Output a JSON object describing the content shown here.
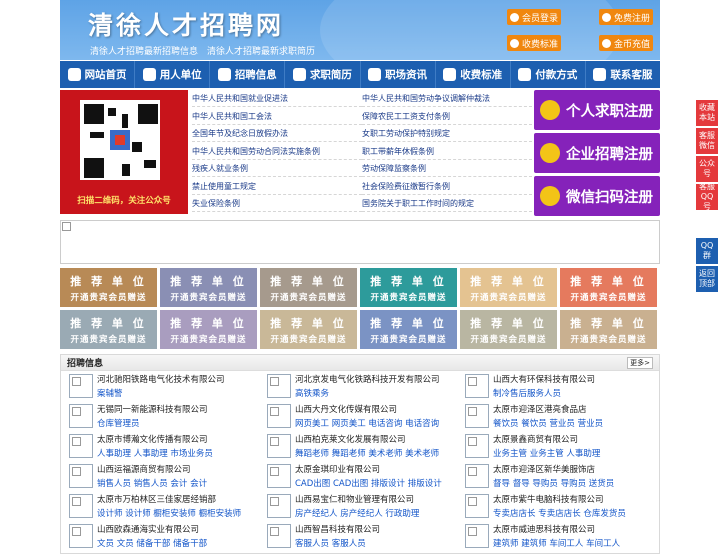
{
  "site": {
    "title": "清徐人才招聘网",
    "slogan": "清徐人才招聘最新招聘信息　清徐人才招聘最新求职简历"
  },
  "header_buttons": [
    "会员登录",
    "免费注册",
    "收费标准",
    "金币充值"
  ],
  "nav": [
    {
      "label": "网站首页",
      "icon": "home-icon"
    },
    {
      "label": "用人单位",
      "icon": "building-icon"
    },
    {
      "label": "招聘信息",
      "icon": "person-icon"
    },
    {
      "label": "求职简历",
      "icon": "resume-icon"
    },
    {
      "label": "职场资讯",
      "icon": "news-icon"
    },
    {
      "label": "收费标准",
      "icon": "coin-icon"
    },
    {
      "label": "付款方式",
      "icon": "card-icon"
    },
    {
      "label": "联系客服",
      "icon": "phone-icon"
    }
  ],
  "qr": {
    "caption": "扫描二维码，关注公众号"
  },
  "laws": [
    "中华人民共和国就业促进法",
    "中华人民共和国劳动争议调解仲裁法",
    "中华人民共和国工会法",
    "保障农民工工资支付条例",
    "全国年节及纪念日放假办法",
    "女职工劳动保护特别规定",
    "中华人民共和国劳动合同法实施条例",
    "职工带薪年休假条例",
    "残疾人就业条例",
    "劳动保障监察条例",
    "禁止使用童工规定",
    "社会保险费征缴暂行条例",
    "失业保险条例",
    "国务院关于职工工作时间的规定"
  ],
  "register": [
    "个人求职注册",
    "企业招聘注册",
    "微信扫码注册"
  ],
  "recommend": {
    "title": "推 荐 单 位",
    "subtitle": "开通贵宾会员赠送",
    "colors": [
      "#b88a56",
      "#8a8fb4",
      "#a69a8d",
      "#2d9b9b",
      "#e4c391",
      "#e57a5e",
      "#9aaab4",
      "#a99dbf",
      "#c9b898",
      "#7b93c4",
      "#b9b6a2",
      "#c9b090"
    ]
  },
  "jobs_section": {
    "title": "招聘信息",
    "more": "更多>"
  },
  "jobs": [
    {
      "company": "河北驰阳铁路电气化技术有限公司",
      "positions": "案辅警"
    },
    {
      "company": "河北京发电气化铁路科技开发有限公司",
      "positions": "高铁乘务"
    },
    {
      "company": "山西大有环保科技有限公司",
      "positions": "制冷售后服务人员"
    },
    {
      "company": "无锡同一新能源科技有限公司",
      "positions": "仓库管理员"
    },
    {
      "company": "山西大丹文化传媒有限公司",
      "positions": "网页美工 网页美工 电话咨询 电话咨询"
    },
    {
      "company": "太原市迎泽区港亮食品店",
      "positions": "餐饮员 餐饮员 营业员 营业员"
    },
    {
      "company": "太原市博瀚文化传播有限公司",
      "positions": "人事助理 人事助理 市场业务员"
    },
    {
      "company": "山西柏克莱文化发展有限公司",
      "positions": "舞蹈老师 舞蹈老师 美术老师 美术老师"
    },
    {
      "company": "太原景鑫商贸有限公司",
      "positions": "业务主管 业务主管 人事助理"
    },
    {
      "company": "山西运福源商贸有限公司",
      "positions": "销售人员 销售人员 会计 会计"
    },
    {
      "company": "太原金琪印业有限公司",
      "positions": "CAD出图 CAD出图 排版设计 排版设计"
    },
    {
      "company": "太原市迎泽区新华美服饰店",
      "positions": "督导 督导 导购员 导购员 送货员"
    },
    {
      "company": "太原市万柏林区三佳家居经销部",
      "positions": "设计师 设计师 橱柜安装师 橱柜安装师"
    },
    {
      "company": "山西易宝仁和物业管理有限公司",
      "positions": "房产经纪人 房产经纪人 行政助理"
    },
    {
      "company": "太原市紫牛电脑科技有限公司",
      "positions": "专卖店店长 专卖店店长 仓库发货员"
    },
    {
      "company": "山西欧森通海实业有限公司",
      "positions": "文员 文员 储备干部 储备干部"
    },
    {
      "company": "山西智昌科技有限公司",
      "positions": "客服人员 客服人员"
    },
    {
      "company": "太原市威迪思科技有限公司",
      "positions": "建筑师 建筑师 车间工人 车间工人"
    }
  ],
  "side": [
    "收藏本站",
    "客服微信",
    "公众号",
    "客服QQ号",
    "QQ群",
    "返回顶部"
  ]
}
